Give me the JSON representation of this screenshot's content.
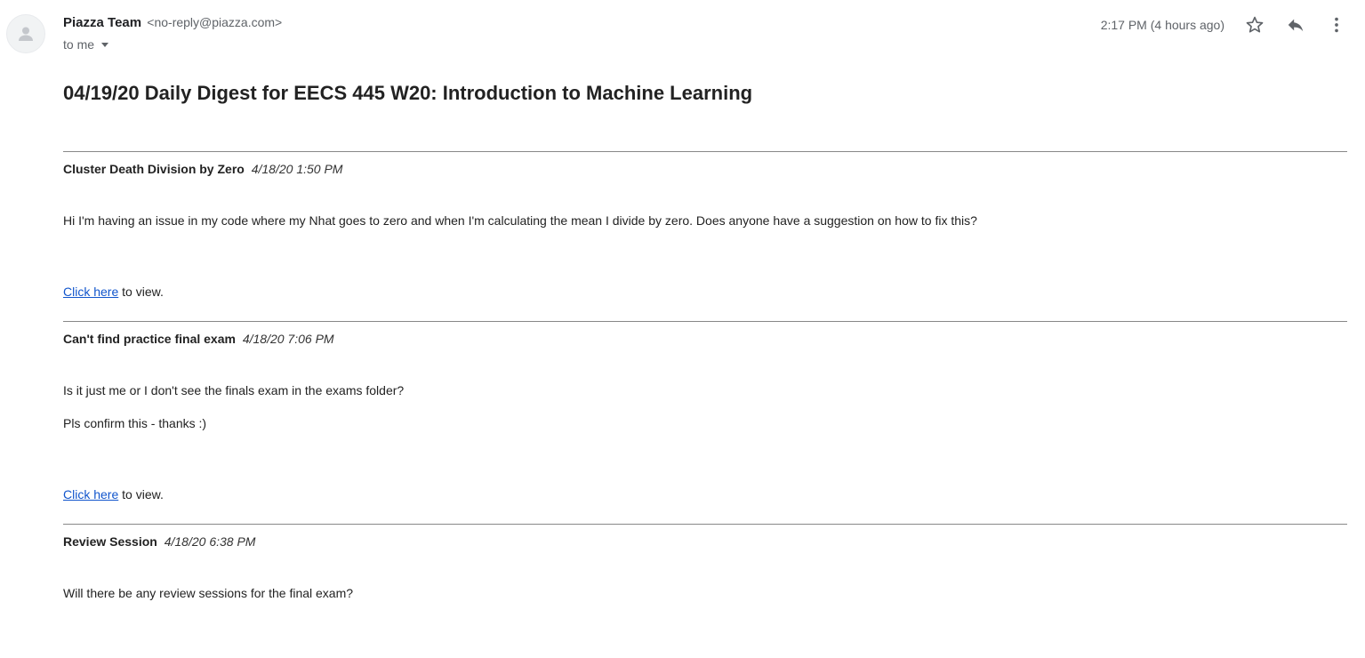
{
  "sender": {
    "name": "Piazza Team",
    "email": "<no-reply@piazza.com>",
    "recipient_label": "to me"
  },
  "time": "2:17 PM (4 hours ago)",
  "icons": {
    "avatar": "person-icon",
    "star": "star-icon",
    "reply": "reply-icon",
    "more": "more-vert-icon",
    "recipient_dropdown": "chevron-down-icon"
  },
  "colors": {
    "link": "#1155cc",
    "divider": "#888888",
    "muted": "#5f6368"
  },
  "subject": "04/19/20 Daily Digest for EECS 445 W20: Introduction to Machine Learning",
  "posts": [
    {
      "title": "Cluster Death Division by Zero",
      "date": "4/18/20 1:50 PM",
      "paragraphs": [
        "Hi I'm having an issue in my code where my Nhat goes to zero and when I'm calculating the mean I divide by zero.  Does anyone have a suggestion on how to fix this?"
      ],
      "link_text": "Click here",
      "link_suffix": " to view."
    },
    {
      "title": "Can't find practice final exam",
      "date": "4/18/20 7:06 PM",
      "paragraphs": [
        "Is it just me or I don't see the finals exam in the exams folder?",
        "Pls confirm this - thanks :)"
      ],
      "link_text": "Click here",
      "link_suffix": " to view."
    },
    {
      "title": "Review Session",
      "date": "4/18/20 6:38 PM",
      "paragraphs": [
        "Will there be any review sessions for the final exam?"
      ]
    }
  ]
}
